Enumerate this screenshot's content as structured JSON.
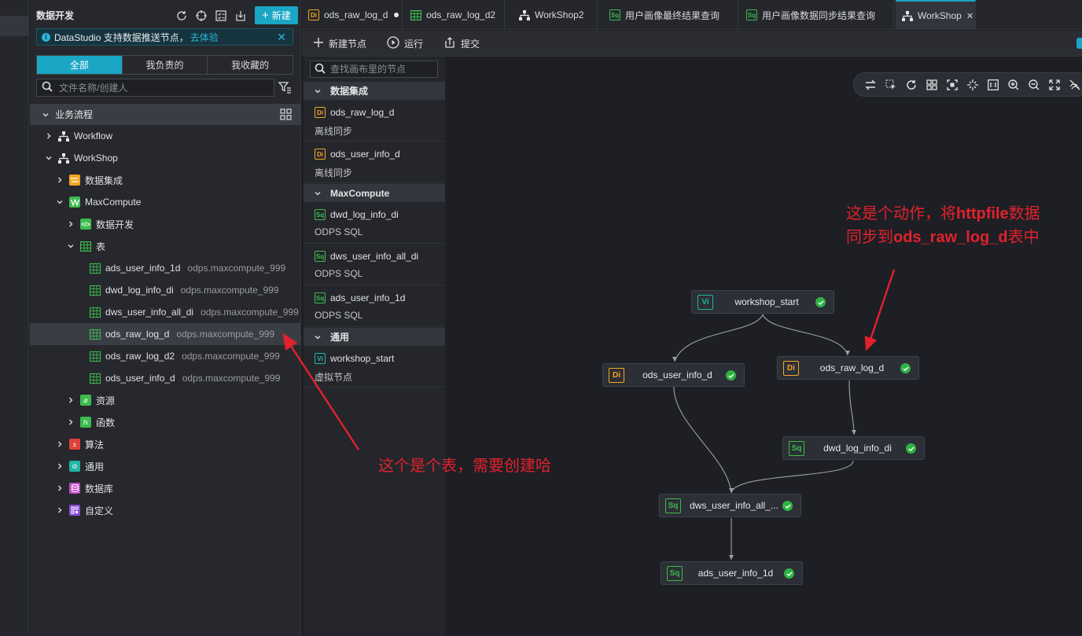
{
  "explorer": {
    "title": "数据开发",
    "new_button": "新建",
    "banner": {
      "text": "DataStudio 支持数据推送节点，",
      "link": "去体验"
    },
    "tabs": [
      "全部",
      "我负责的",
      "我收藏的"
    ],
    "search_placeholder": "文件名称/创建人",
    "section": "业务流程",
    "tree": {
      "workflow": "Workflow",
      "workshop": "WorkShop",
      "data_integration": "数据集成",
      "maxcompute": "MaxCompute",
      "data_dev": "数据开发",
      "tables": "表",
      "table_rows": [
        {
          "name": "ads_user_info_1d",
          "project": "odps.maxcompute_999"
        },
        {
          "name": "dwd_log_info_di",
          "project": "odps.maxcompute_999"
        },
        {
          "name": "dws_user_info_all_di",
          "project": "odps.maxcompute_999"
        },
        {
          "name": "ods_raw_log_d",
          "project": "odps.maxcompute_999"
        },
        {
          "name": "ods_raw_log_d2",
          "project": "odps.maxcompute_999"
        },
        {
          "name": "ods_user_info_d",
          "project": "odps.maxcompute_999"
        }
      ],
      "resources": "资源",
      "functions": "函数",
      "algorithm": "算法",
      "general": "通用",
      "database": "数据库",
      "custom": "自定义"
    }
  },
  "editor_tabs": [
    {
      "label": "ods_raw_log_d",
      "icon": "Di"
    },
    {
      "label": "ods_raw_log_d2",
      "icon": "table"
    },
    {
      "label": "WorkShop2",
      "icon": "flow"
    },
    {
      "label": "用户画像最终结果查询",
      "icon": "Sq"
    },
    {
      "label": "用户画像数据同步结果查询",
      "icon": "Sq"
    },
    {
      "label": "WorkShop",
      "icon": "flow"
    }
  ],
  "toolbar": {
    "new_node": "新建节点",
    "run": "运行",
    "submit": "提交"
  },
  "node_panel": {
    "search_placeholder": "查找画布里的节点",
    "groups": [
      {
        "name": "数据集成",
        "items": [
          {
            "name": "ods_raw_log_d",
            "type": "离线同步",
            "badge": "Di"
          },
          {
            "name": "ods_user_info_d",
            "type": "离线同步",
            "badge": "Di"
          }
        ]
      },
      {
        "name": "MaxCompute",
        "items": [
          {
            "name": "dwd_log_info_di",
            "type": "ODPS SQL",
            "badge": "Sq"
          },
          {
            "name": "dws_user_info_all_di",
            "type": "ODPS SQL",
            "badge": "Sq"
          },
          {
            "name": "ads_user_info_1d",
            "type": "ODPS SQL",
            "badge": "Sq"
          }
        ]
      },
      {
        "name": "通用",
        "items": [
          {
            "name": "workshop_start",
            "type": "虚拟节点",
            "badge": "Vi"
          }
        ]
      }
    ]
  },
  "canvas_nodes": {
    "workshop_start": {
      "label": "workshop_start",
      "badge": "Vi"
    },
    "ods_user_info_d": {
      "label": "ods_user_info_d",
      "badge": "Di"
    },
    "ods_raw_log_d": {
      "label": "ods_raw_log_d",
      "badge": "Di"
    },
    "dwd_log_info_di": {
      "label": "dwd_log_info_di",
      "badge": "Sq"
    },
    "dws_user_info_all": {
      "label": "dws_user_info_all_...",
      "badge": "Sq"
    },
    "ads_user_info_1d": {
      "label": "ads_user_info_1d",
      "badge": "Sq"
    }
  },
  "annotations": {
    "table_note": "这个是个表，需要创建哈",
    "action_line1_a": "这是个动作，将",
    "action_line1_b": "httpfile",
    "action_line1_c": "数据",
    "action_line2_a": "同步到",
    "action_line2_b": "ods_raw_log_d",
    "action_line2_c": "表中"
  },
  "colors": {
    "accent": "#1aa6c5",
    "di": "#f5a623",
    "sq": "#3dbb4f",
    "vi": "#1fb5a7",
    "annotation": "#e2212d",
    "success": "#2fb344"
  }
}
